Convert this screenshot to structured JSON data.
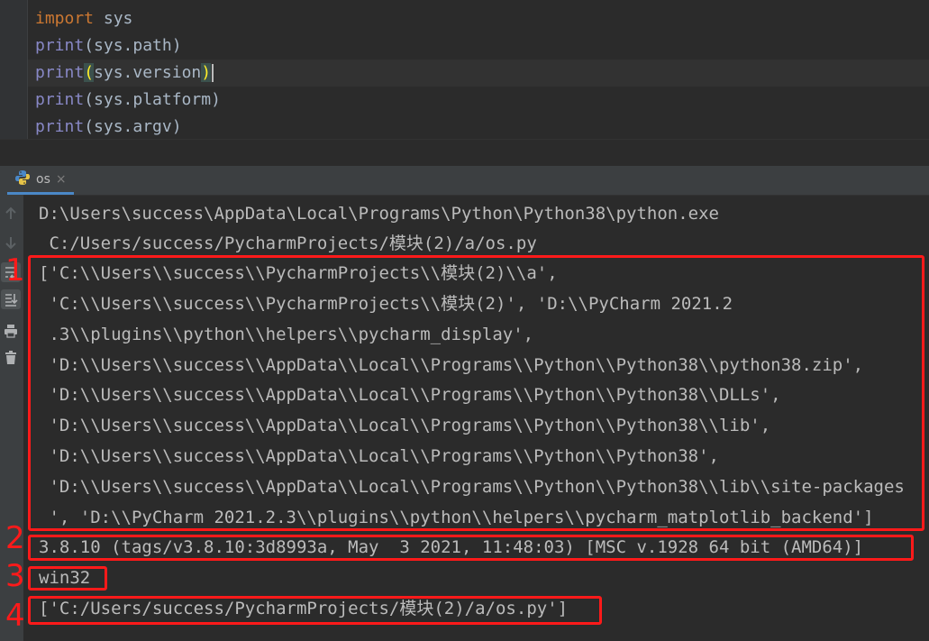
{
  "editor": {
    "lines": [
      {
        "kw": "import",
        "rest": " sys"
      },
      {
        "fn": "print",
        "pre": "(sys.path)"
      },
      {
        "fn": "print",
        "open": "(",
        "mid": "sys.version",
        "close": ")"
      },
      {
        "fn": "print",
        "pre": "(sys.platform)"
      },
      {
        "fn": "print",
        "pre": "(sys.argv)"
      }
    ]
  },
  "run_tab": {
    "label": "os",
    "close": "×"
  },
  "console": {
    "lines": [
      "D:\\Users\\success\\AppData\\Local\\Programs\\Python\\Python38\\python.exe",
      " C:/Users/success/PycharmProjects/模块(2)/a/os.py",
      "['C:\\\\Users\\\\success\\\\PycharmProjects\\\\模块(2)\\\\a',",
      " 'C:\\\\Users\\\\success\\\\PycharmProjects\\\\模块(2)', 'D:\\\\PyCharm 2021.2",
      " .3\\\\plugins\\\\python\\\\helpers\\\\pycharm_display',",
      " 'D:\\\\Users\\\\success\\\\AppData\\\\Local\\\\Programs\\\\Python\\\\Python38\\\\python38.zip',",
      " 'D:\\\\Users\\\\success\\\\AppData\\\\Local\\\\Programs\\\\Python\\\\Python38\\\\DLLs',",
      " 'D:\\\\Users\\\\success\\\\AppData\\\\Local\\\\Programs\\\\Python\\\\Python38\\\\lib',",
      " 'D:\\\\Users\\\\success\\\\AppData\\\\Local\\\\Programs\\\\Python\\\\Python38',",
      " 'D:\\\\Users\\\\success\\\\AppData\\\\Local\\\\Programs\\\\Python\\\\Python38\\\\lib\\\\site-packages",
      " ', 'D:\\\\PyCharm 2021.2.3\\\\plugins\\\\python\\\\helpers\\\\pycharm_matplotlib_backend']",
      "3.8.10 (tags/v3.8.10:3d8993a, May  3 2021, 11:48:03) [MSC v.1928 64 bit (AMD64)]",
      "win32",
      "['C:/Users/success/PycharmProjects/模块(2)/a/os.py']"
    ]
  },
  "annotations": [
    "1",
    "2",
    "3",
    "4"
  ],
  "colors": {
    "highlight": "#ff1a1a",
    "keyword": "#cc7832",
    "builtin": "#8888c6",
    "console_text": "#bbbbbb"
  },
  "icons": [
    "python-icon",
    "up-arrow-icon",
    "down-arrow-icon",
    "soft-wrap-icon",
    "scroll-to-end-icon",
    "print-icon",
    "trash-icon"
  ]
}
